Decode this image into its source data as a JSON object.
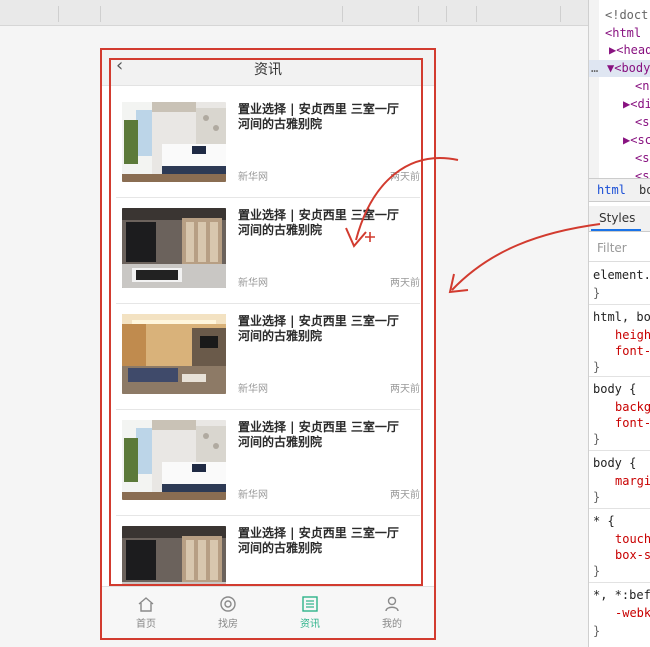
{
  "header": {
    "back_symbol": "‹",
    "title": "资讯"
  },
  "news": [
    {
      "headline": "置业选择 | 安贞西里 三室一厅 河间的古雅别院",
      "source": "新华网",
      "time": "两天前",
      "thumb": "bedroom"
    },
    {
      "headline": "置业选择 | 安贞西里 三室一厅 河间的古雅别院",
      "source": "新华网",
      "time": "两天前",
      "thumb": "living-dark"
    },
    {
      "headline": "置业选择 | 安贞西里 三室一厅 河间的古雅别院",
      "source": "新华网",
      "time": "两天前",
      "thumb": "living-warm"
    },
    {
      "headline": "置业选择 | 安贞西里 三室一厅 河间的古雅别院",
      "source": "新华网",
      "time": "两天前",
      "thumb": "bedroom"
    },
    {
      "headline": "置业选择 | 安贞西里 三室一厅 河间的古雅别院",
      "source": "",
      "time": "",
      "thumb": "living-dark"
    }
  ],
  "tabbar": [
    {
      "label": "首页",
      "icon": "home-icon",
      "active": false
    },
    {
      "label": "找房",
      "icon": "search-icon",
      "active": false
    },
    {
      "label": "资讯",
      "icon": "news-icon",
      "active": true
    },
    {
      "label": "我的",
      "icon": "user-icon",
      "active": false
    }
  ],
  "devtools": {
    "elements": [
      "<!doct",
      "<html",
      "▶<head",
      "▼<body",
      "<no",
      "▶<di",
      "<sc",
      "▶<sc",
      "<sc",
      "<sc"
    ],
    "panel_tabs": [
      "html",
      "bo"
    ],
    "sub_tab": "Styles",
    "filter_placeholder": "Filter",
    "rules": [
      {
        "selector": "element.",
        "props": [
          "}"
        ]
      },
      {
        "selector": "html, bo",
        "props": [
          "heigh",
          "font-",
          "}"
        ]
      },
      {
        "selector": "body {",
        "props": [
          "backg",
          "font-",
          "}"
        ]
      },
      {
        "selector": "body {",
        "props": [
          "margi",
          "}"
        ]
      },
      {
        "selector": "* {",
        "props": [
          "touch",
          "box-s",
          "}"
        ]
      },
      {
        "selector": "*, *:bef",
        "props": [
          "-webk",
          "}"
        ]
      }
    ]
  },
  "colors": {
    "accent_green": "#2db38a",
    "annotation_red": "#d23b2f"
  }
}
